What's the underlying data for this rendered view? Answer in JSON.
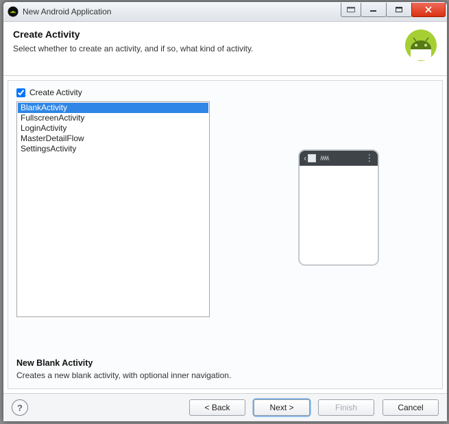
{
  "window": {
    "title": "New Android Application"
  },
  "header": {
    "title": "Create Activity",
    "subtitle": "Select whether to create an activity, and if so, what kind of activity."
  },
  "create_checkbox": {
    "label": "Create Activity",
    "checked": true
  },
  "activities": [
    {
      "name": "BlankActivity",
      "selected": true
    },
    {
      "name": "FullscreenActivity",
      "selected": false
    },
    {
      "name": "LoginActivity",
      "selected": false
    },
    {
      "name": "MasterDetailFlow",
      "selected": false
    },
    {
      "name": "SettingsActivity",
      "selected": false
    }
  ],
  "description": {
    "title": "New Blank Activity",
    "text": "Creates a new blank activity, with optional inner navigation."
  },
  "footer": {
    "back": "< Back",
    "next": "Next >",
    "finish": "Finish",
    "cancel": "Cancel"
  }
}
